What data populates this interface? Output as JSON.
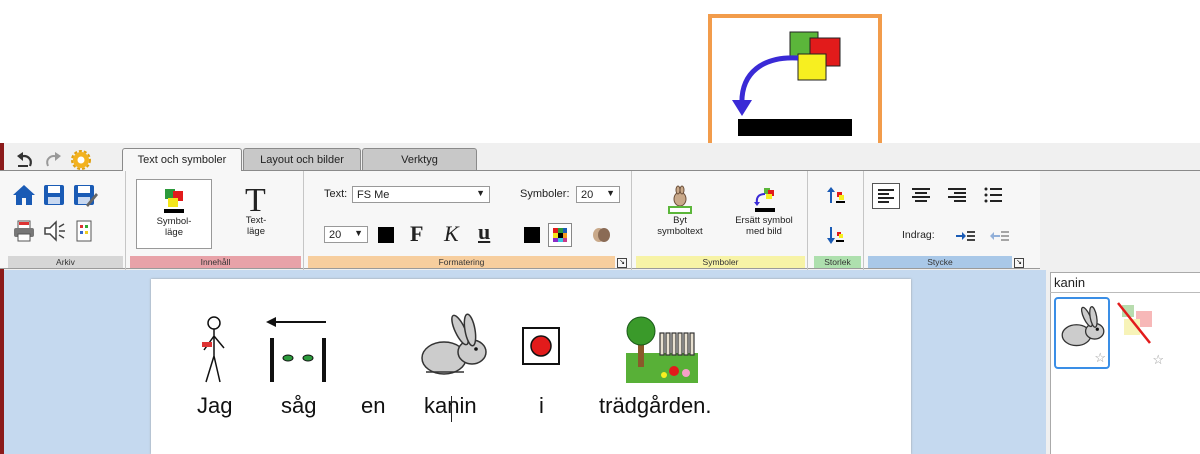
{
  "tabs": [
    {
      "label": "Text och symboler",
      "active": true
    },
    {
      "label": "Layout och bilder",
      "active": false
    },
    {
      "label": "Verktyg",
      "active": false
    }
  ],
  "groups": {
    "arkiv": "Arkiv",
    "innehall": "Innehåll",
    "formatering": "Formatering",
    "symboler": "Symboler",
    "storlek": "Storlek",
    "stycke": "Stycke"
  },
  "innehall": {
    "symbol_mode": "Symbol-\nläge",
    "text_mode": "Text-\nläge"
  },
  "formatering": {
    "text_label": "Text:",
    "text_font": "FS Me",
    "symbols_label": "Symboler:",
    "symbols_size": "20",
    "text_size": "20",
    "bold": "F",
    "italic": "K",
    "underline": "u"
  },
  "symboler": {
    "swap_text": "Byt\nsymboltext",
    "replace_symbol": "Ersätt symbol\nmed bild"
  },
  "stycke": {
    "indent_label": "Indrag:"
  },
  "document": {
    "words": [
      "Jag",
      "såg",
      "en",
      "kanin",
      "i",
      "trädgården."
    ]
  },
  "panel": {
    "title": "kanin"
  },
  "colors": {
    "accent_orange": "#f29c4b",
    "innehall_strip": "#e8a2a8",
    "formatering_strip": "#f7ce9e",
    "symboler_strip": "#f7f3a6",
    "storlek_strip": "#aee0ae",
    "stycke_strip": "#a9c8e8",
    "arkiv_strip": "#d6d6d6",
    "doc_bg": "#c5d9ef"
  },
  "icons": [
    "undo-icon",
    "redo-icon",
    "settings-icon",
    "home-icon",
    "save-icon",
    "save-as-icon",
    "print-icon",
    "speaker-icon",
    "document-icon",
    "symbol-mode-icon",
    "text-mode-icon",
    "color-square-icon",
    "color-palette-icon",
    "eraser-icon",
    "swap-symbol-text-icon",
    "replace-symbol-icon",
    "size-increase-icon",
    "size-decrease-icon",
    "align-left-icon",
    "align-center-icon",
    "align-right-icon",
    "list-icon",
    "indent-increase-icon",
    "indent-decrease-icon",
    "rabbit-symbol-icon",
    "no-symbol-icon",
    "star-icon"
  ]
}
